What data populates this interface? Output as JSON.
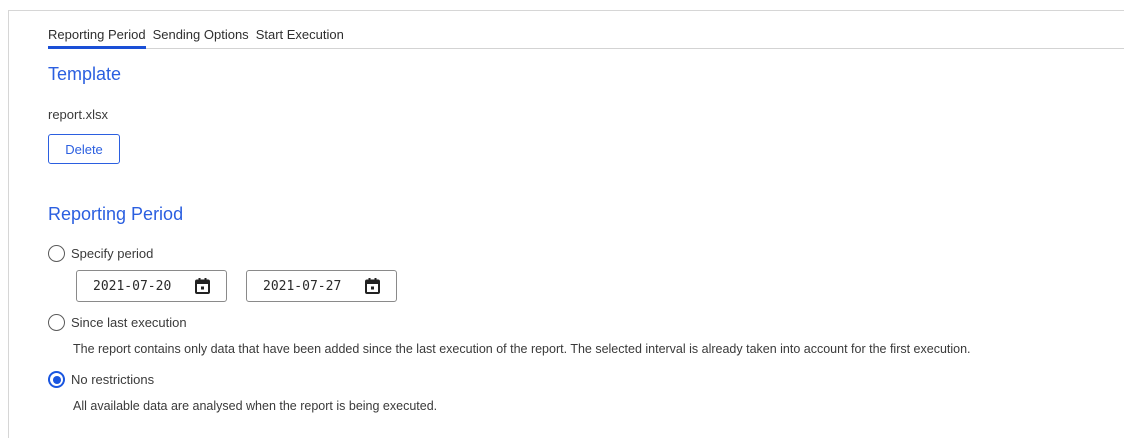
{
  "tabs": [
    {
      "label": "Reporting Period",
      "active": true
    },
    {
      "label": "Sending Options",
      "active": false
    },
    {
      "label": "Start Execution",
      "active": false
    }
  ],
  "template": {
    "heading": "Template",
    "filename": "report.xlsx",
    "delete_label": "Delete"
  },
  "period": {
    "heading": "Reporting Period",
    "options": [
      {
        "label": "Specify period",
        "checked": false
      },
      {
        "label": "Since last execution",
        "checked": false,
        "description": "The report contains only data that have been added since the last execution of the report. The selected interval is already taken into account for the first execution."
      },
      {
        "label": "No restrictions",
        "checked": true,
        "description": "All available data are analysed when the report is being executed."
      }
    ],
    "date_from": "2021-07-20",
    "date_to": "2021-07-27"
  },
  "colors": {
    "accent": "#2b5fe0",
    "tab_underline": "#1a4fd6"
  },
  "icons": {
    "date_picker": "calendar-icon"
  }
}
